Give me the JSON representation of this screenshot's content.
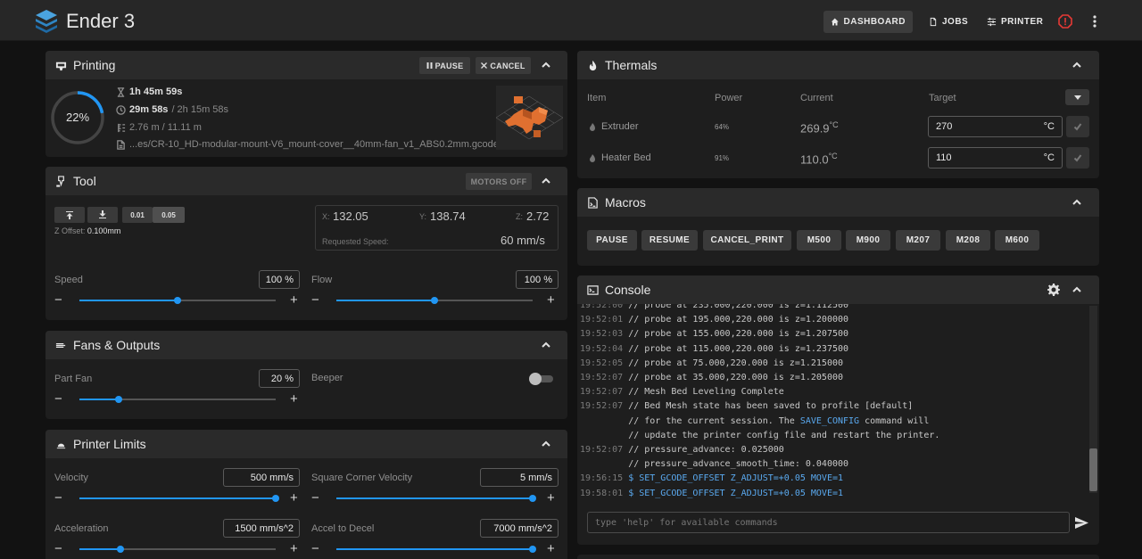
{
  "app": {
    "title": "Ender 3"
  },
  "nav": {
    "dashboard": "DASHBOARD",
    "jobs": "JOBS",
    "printer": "PRINTER"
  },
  "printing": {
    "title": "Printing",
    "pause": "PAUSE",
    "cancel": "CANCEL",
    "progress_text": "22%",
    "progress": 0.22,
    "elapsed": "1h 45m 59s",
    "remaining": "29m 58s",
    "total": "/ 2h 15m 58s",
    "filament": "2.76 m / 11.11 m",
    "filename": "...es/CR-10_HD-modular-mount-V6_mount-cover__40mm-fan_v1_ABS0.2mm.gcode"
  },
  "tool": {
    "title": "Tool",
    "motors_off": "MOTORS OFF",
    "step_a": "0.01",
    "step_b": "0.05",
    "z_offset_label": "Z Offset:",
    "z_offset_value": "0.100mm",
    "x_label": "X:",
    "x_value": "132.05",
    "y_label": "Y:",
    "y_value": "138.74",
    "z_label": "Z:",
    "z_value": "2.72",
    "req_speed_label": "Requested Speed:",
    "req_speed_value": "60 mm/s",
    "speed_label": "Speed",
    "speed_value": "100 %",
    "speed_pos": 0.5,
    "flow_label": "Flow",
    "flow_value": "100 %",
    "flow_pos": 0.5
  },
  "fans": {
    "title": "Fans & Outputs",
    "part_fan_label": "Part Fan",
    "part_fan_value": "20 %",
    "part_fan_pos": 0.2,
    "beeper_label": "Beeper"
  },
  "limits": {
    "title": "Printer Limits",
    "velocity_label": "Velocity",
    "velocity_value": "500 mm/s",
    "velocity_pos": 1.0,
    "scv_label": "Square Corner Velocity",
    "scv_value": "5 mm/s",
    "scv_pos": 1.0,
    "accel_label": "Acceleration",
    "accel_value": "1500 mm/s^2",
    "accel_pos": 0.21,
    "decel_label": "Accel to Decel",
    "decel_value": "7000 mm/s^2",
    "decel_pos": 1.0
  },
  "thermals": {
    "title": "Thermals",
    "col_item": "Item",
    "col_power": "Power",
    "col_current": "Current",
    "col_target": "Target",
    "rows": [
      {
        "name": "Extruder",
        "power": "64%",
        "current": "269.9",
        "unit": "°C",
        "target": "270",
        "target_unit": "°C"
      },
      {
        "name": "Heater Bed",
        "power": "91%",
        "current": "110.0",
        "unit": "°C",
        "target": "110",
        "target_unit": "°C"
      }
    ]
  },
  "macros": {
    "title": "Macros",
    "buttons": [
      "PAUSE",
      "RESUME",
      "CANCEL_PRINT",
      "M500",
      "M900",
      "M207",
      "M208",
      "M600"
    ]
  },
  "console": {
    "title": "Console",
    "placeholder": "type 'help' for available commands",
    "lines": [
      {
        "ts": "19:52:00",
        "text": "// probe at 235.000,220.000 is z=1.112500"
      },
      {
        "ts": "19:52:01",
        "text": "// probe at 195.000,220.000 is z=1.200000"
      },
      {
        "ts": "19:52:03",
        "text": "// probe at 155.000,220.000 is z=1.207500"
      },
      {
        "ts": "19:52:04",
        "text": "// probe at 115.000,220.000 is z=1.237500"
      },
      {
        "ts": "19:52:05",
        "text": "// probe at 75.000,220.000 is z=1.215000"
      },
      {
        "ts": "19:52:07",
        "text": "// probe at 35.000,220.000 is z=1.205000"
      },
      {
        "ts": "19:52:07",
        "text": "// Mesh Bed Leveling Complete"
      },
      {
        "ts": "19:52:07",
        "text": "// Bed Mesh state has been saved to profile [default]"
      },
      {
        "ts": "",
        "text": "// for the current session. The ",
        "link": "SAVE_CONFIG",
        "after": " command will"
      },
      {
        "ts": "",
        "text": "// update the printer config file and restart the printer."
      },
      {
        "ts": "19:52:07",
        "text": "// pressure_advance: 0.025000"
      },
      {
        "ts": "",
        "text": "// pressure_advance_smooth_time: 0.040000"
      },
      {
        "ts": "19:56:15",
        "cmd": "$ SET_GCODE_OFFSET Z_ADJUST=+0.05 MOVE=1"
      },
      {
        "ts": "19:58:01",
        "cmd": "$ SET_GCODE_OFFSET Z_ADJUST=+0.05 MOVE=1"
      }
    ]
  },
  "colors": {
    "accent": "#2196f3",
    "alert": "#e53935",
    "thumbnail": "#e07030"
  }
}
